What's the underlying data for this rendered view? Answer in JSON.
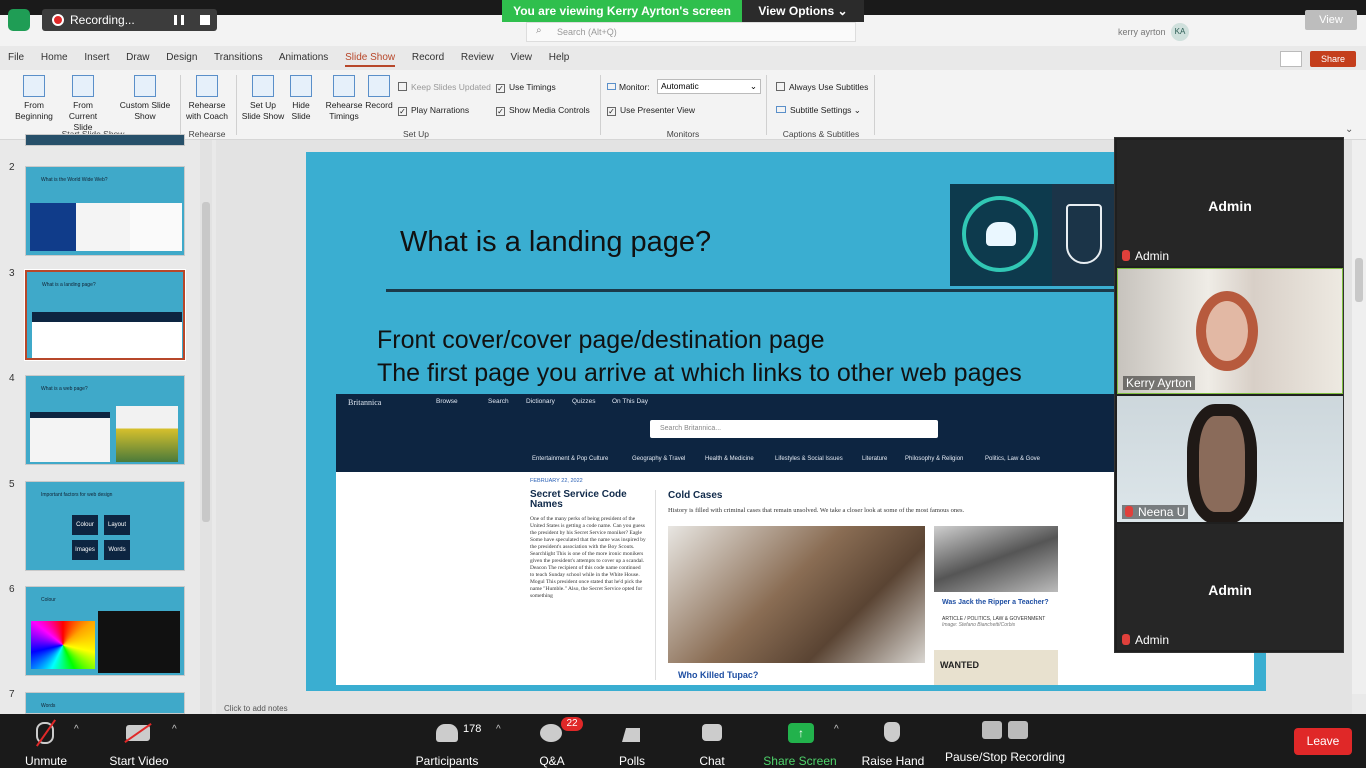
{
  "zoom_top": {
    "recording_label": "Recording...",
    "viewing_banner": "You are viewing Kerry Ayrton's screen",
    "view_options": "View Options",
    "view_button": "View"
  },
  "app": {
    "search_placeholder": "Search (Alt+Q)",
    "user_name": "kerry ayrton",
    "user_initials": "KA",
    "share_label": "Share"
  },
  "menus": [
    "File",
    "Home",
    "Insert",
    "Draw",
    "Design",
    "Transitions",
    "Animations",
    "Slide Show",
    "Record",
    "Review",
    "View",
    "Help"
  ],
  "ribbon": {
    "from_beginning": "From Beginning",
    "from_current": "From Current Slide",
    "custom_show": "Custom Slide Show",
    "rehearse_coach": "Rehearse with Coach",
    "setup_show": "Set Up Slide Show",
    "hide_slide": "Hide Slide",
    "rehearse_timings": "Rehearse Timings",
    "record": "Record",
    "keep_updated": "Keep Slides Updated",
    "use_timings": "Use Timings",
    "play_narrations": "Play Narrations",
    "show_media": "Show Media Controls",
    "monitor_label": "Monitor:",
    "monitor_value": "Automatic",
    "presenter_view": "Use Presenter View",
    "always_subtitles": "Always Use Subtitles",
    "subtitle_settings": "Subtitle Settings",
    "groups": {
      "start": "Start Slide Show",
      "rehearse": "Rehearse",
      "setup": "Set Up",
      "monitors": "Monitors",
      "captions": "Captions & Subtitles"
    }
  },
  "thumbnails": [
    {
      "num": "2",
      "title": "What is the World Wide Web?"
    },
    {
      "num": "3",
      "title": "What is a landing page?"
    },
    {
      "num": "4",
      "title": "What is a web page?"
    },
    {
      "num": "5",
      "title": "Important factors for web design"
    },
    {
      "num": "6",
      "title": "Colour"
    },
    {
      "num": "7",
      "title": "Words"
    }
  ],
  "thumb5_words": [
    "Colour",
    "Layout",
    "Images",
    "Words"
  ],
  "slide": {
    "title": "What is a landing page?",
    "line1": "Front cover/cover page/destination page",
    "line2": "The first page you arrive at which links to other web pages"
  },
  "britannica": {
    "brand": "Britannica",
    "nav": [
      "Browse",
      "Search",
      "Dictionary",
      "Quizzes",
      "On This Day"
    ],
    "search_placeholder": "Search Britannica...",
    "categories": [
      "Entertainment & Pop Culture",
      "Geography & Travel",
      "Health & Medicine",
      "Lifestyles & Social Issues",
      "Literature",
      "Philosophy & Religion",
      "Politics, Law & Gove"
    ],
    "date": "FEBRUARY 22, 2022",
    "headline1": "Secret Service Code Names",
    "copy1": "One of the many perks of being president of the United States is getting a code name. Can you guess the president by his Secret Service moniker? Eagle Some have speculated that the name was inspired by the president's association with the Boy Scouts. Searchlight This is one of the more ironic monikers given the president's attempts to cover up a scandal. Deacon The recipient of this code name continued to teach Sunday school while in the White House. Mogul This president once stated that he'd pick the name \"Humble.\" Also, the Secret Service opted for something",
    "headline2": "Cold Cases",
    "sub2": "History is filled with criminal cases that remain unsolved. We take a closer look at some of the most famous ones.",
    "caption_main": "Who Killed Tupac?",
    "caption_side": "Was Jack the Ripper a Teacher?",
    "meta_side": "ARTICLE / POLITICS, LAW & GOVERNMENT",
    "credit_side": "Image: Stefano Bianchetti/Corbis",
    "wanted": "WANTED"
  },
  "notes_placeholder": "Click to add notes",
  "participants_panel": [
    {
      "name": "Admin",
      "label": "Admin",
      "video": false
    },
    {
      "name": "Kerry Ayrton",
      "label": "Kerry Ayrton",
      "video": true
    },
    {
      "name": "Neena U",
      "label": "Neena U",
      "video": true
    },
    {
      "name": "Admin",
      "label": "Admin",
      "video": false
    }
  ],
  "zoom_bottom": {
    "unmute": "Unmute",
    "start_video": "Start Video",
    "participants": "Participants",
    "participants_count": "178",
    "qa": "Q&A",
    "qa_badge": "22",
    "polls": "Polls",
    "chat": "Chat",
    "share_screen": "Share Screen",
    "raise_hand": "Raise Hand",
    "pause_stop": "Pause/Stop Recording",
    "leave": "Leave"
  },
  "colors": {
    "accent": "#b7472a",
    "slide_bg": "#3aaed1",
    "zoom_green": "#2fbf4d",
    "leave_red": "#e02828"
  }
}
